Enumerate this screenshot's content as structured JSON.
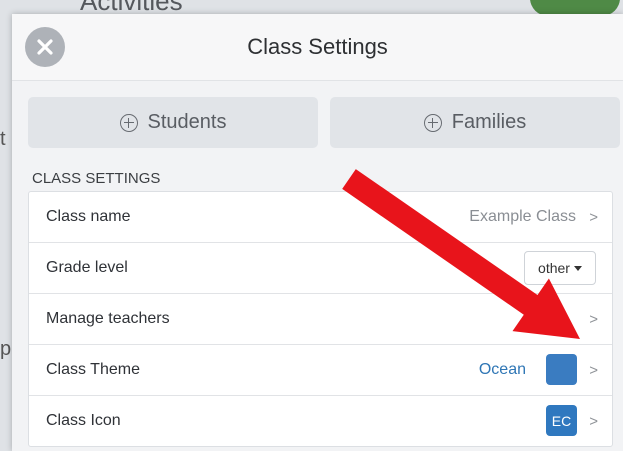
{
  "background": {
    "title_fragment": "Activities",
    "left_letter_1": "t",
    "left_letter_2": "p"
  },
  "modal": {
    "title": "Class Settings",
    "close_icon": "close-icon",
    "actions": [
      {
        "label": "Students",
        "icon": "plus-circle-icon"
      },
      {
        "label": "Families",
        "icon": "plus-circle-icon"
      }
    ],
    "section_header": "CLASS SETTINGS",
    "settings": {
      "class_name": {
        "label": "Class name",
        "value": "Example Class"
      },
      "grade_level": {
        "label": "Grade level",
        "value": "other"
      },
      "manage_teachers": {
        "label": "Manage teachers"
      },
      "class_theme": {
        "label": "Class Theme",
        "value": "Ocean",
        "color": "#3a7cc1"
      },
      "class_icon": {
        "label": "Class Icon",
        "value": "EC",
        "color": "#2f78bf"
      }
    },
    "chevron": ">"
  },
  "annotation": {
    "arrow_color": "#e8141b"
  }
}
